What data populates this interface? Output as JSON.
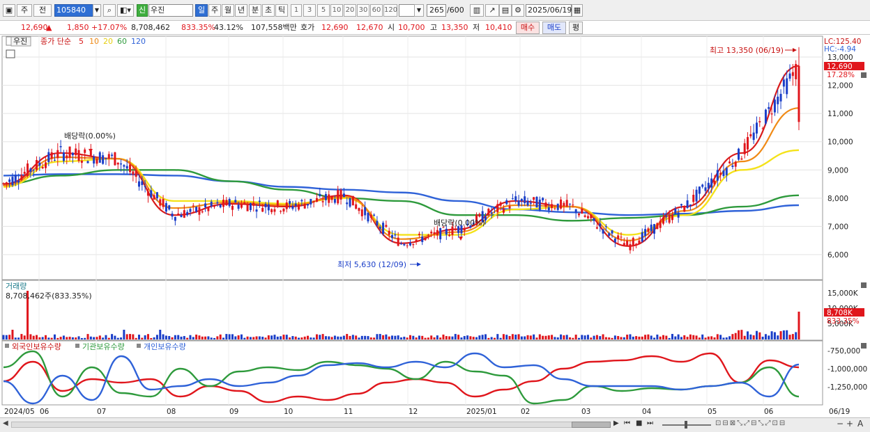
{
  "toolbar": {
    "market": "주",
    "prev_label": "전",
    "code": "105840",
    "new_badge": "신",
    "stock_name": "우진",
    "periods": [
      "일",
      "주",
      "월",
      "년",
      "분",
      "초",
      "틱"
    ],
    "selected_period": "일",
    "intervals": [
      "1",
      "3",
      "5",
      "10",
      "20",
      "30",
      "60",
      "120"
    ],
    "count": "265",
    "count_total": "/600",
    "date": "2025/06/19"
  },
  "quote": {
    "price": "12,690",
    "change_arrow": "▲",
    "change": "1,850",
    "change_pct": "+17.07%",
    "volume": "8,708,462",
    "volume_ratio": "833.35%",
    "turnover_pct": "43.12%",
    "amount": "107,558백만",
    "hoga_label": "호가",
    "hoga_ask": "12,690",
    "hoga_bid": "12,670",
    "open_label": "시",
    "open": "10,700",
    "high_label": "고",
    "high": "13,350",
    "low_label": "저",
    "low": "10,410",
    "buy_label": "매수",
    "sell_label": "매도",
    "eval_label": "평"
  },
  "price_panel": {
    "name_tab": "우진",
    "ma_label": "종가 단순",
    "ma_periods": [
      "5",
      "10",
      "20",
      "60",
      "120"
    ],
    "lc_label": "LC:125.40",
    "hc_label": "HC:-4.94",
    "y_ticks": [
      "13,000",
      "12,000",
      "11,000",
      "10,000",
      "9,000",
      "8,000",
      "7,000",
      "6,000"
    ],
    "current_price_tag": "12,690",
    "current_pct_tag": "17.28%",
    "high_annotation": "최고 13,350 (06/19)",
    "low_annotation": "최저 5,630 (12/09)",
    "dividend_1": "배당락(0.00%)",
    "dividend_2": "배당락(0.00%)"
  },
  "volume_panel": {
    "title": "거래량",
    "value": "8,708,462주(833.35%)",
    "y_ticks": [
      "15,000K",
      "10,000K",
      "5,000K"
    ],
    "current_tag": "8,708K",
    "current_pct": "833.35%"
  },
  "holdings_panel": {
    "legend": [
      "외국인보유수량",
      "기관보유수량",
      "개인보유수량"
    ],
    "y_ticks": [
      "-750,000",
      "-1,000,000",
      "-1,250,000"
    ]
  },
  "x_axis": [
    "2024/05",
    "06",
    "07",
    "08",
    "09",
    "10",
    "11",
    "12",
    "2025/01",
    "02",
    "03",
    "04",
    "05",
    "06",
    "06/19"
  ],
  "colors": {
    "up": "#e0161c",
    "down": "#1a3ec8",
    "ma5": "#d91a1a",
    "ma10": "#f08a16",
    "ma20": "#f4e21a",
    "ma60": "#2e9a3c",
    "ma120": "#2f62d8",
    "foreign": "#e0161c",
    "institution": "#2e9a3c",
    "individual": "#2f62d8"
  },
  "chart_data": {
    "type": "line",
    "title": "",
    "x": [
      "2024/05",
      "06",
      "07",
      "08",
      "09",
      "10",
      "11",
      "12",
      "2025/01",
      "02",
      "03",
      "04",
      "05",
      "06",
      "06/19"
    ],
    "series": [
      {
        "name": "5",
        "values": [
          8500,
          9600,
          9400,
          7400,
          7800,
          7700,
          8100,
          6400,
          6900,
          7900,
          7700,
          6300,
          7700,
          9600,
          12690
        ]
      },
      {
        "name": "20",
        "values": [
          8400,
          9300,
          9400,
          7900,
          7900,
          7800,
          8000,
          6700,
          6700,
          7600,
          7700,
          6700,
          7400,
          9000,
          9700
        ]
      },
      {
        "name": "60",
        "values": [
          8500,
          8800,
          9000,
          9000,
          8600,
          8300,
          8000,
          7900,
          7400,
          7400,
          7200,
          7300,
          7400,
          7700,
          8100
        ]
      },
      {
        "name": "120",
        "values": [
          8800,
          8850,
          8850,
          8800,
          8600,
          8400,
          8300,
          8200,
          7900,
          7600,
          7500,
          7400,
          7450,
          7550,
          7750
        ]
      }
    ],
    "ylabel": "",
    "ylim": [
      5500,
      13500
    ]
  }
}
